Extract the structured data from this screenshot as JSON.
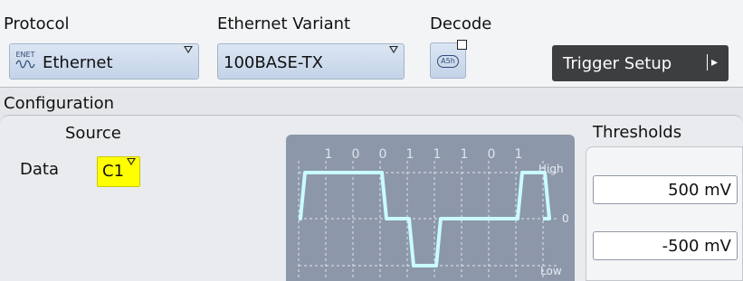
{
  "protocol": {
    "label": "Protocol",
    "value": "Ethernet",
    "icon_text_top": "ENET",
    "icon": "ethernet-protocol-icon"
  },
  "variant": {
    "label": "Ethernet Variant",
    "value": "100BASE-TX"
  },
  "decode": {
    "label": "Decode",
    "icon_text": "A5h",
    "icon": "hex-decode-icon",
    "enabled": false
  },
  "trigger": {
    "label": "Trigger Setup",
    "icon": "play-arrow-icon"
  },
  "configuration": {
    "title": "Configuration",
    "source_title": "Source",
    "data_label": "Data",
    "data_channel": "C1",
    "waveform": {
      "bits": [
        "1",
        "0",
        "0",
        "1",
        "1",
        "1",
        "0",
        "1"
      ],
      "levels": [
        1,
        1,
        1,
        0,
        -1,
        0,
        0,
        0,
        1,
        0
      ],
      "high_label": "High",
      "zero_label": "0",
      "low_label": "Low"
    }
  },
  "thresholds": {
    "title": "Thresholds",
    "high": "500 mV",
    "low": "-500 mV"
  },
  "colors": {
    "trigger_button": "#3d3e40",
    "channel_c1": "#ffff00",
    "waveform_bg": "#8c97a9",
    "waveform_line": "#c9fbff",
    "dropdown": "#c4d3e8"
  }
}
